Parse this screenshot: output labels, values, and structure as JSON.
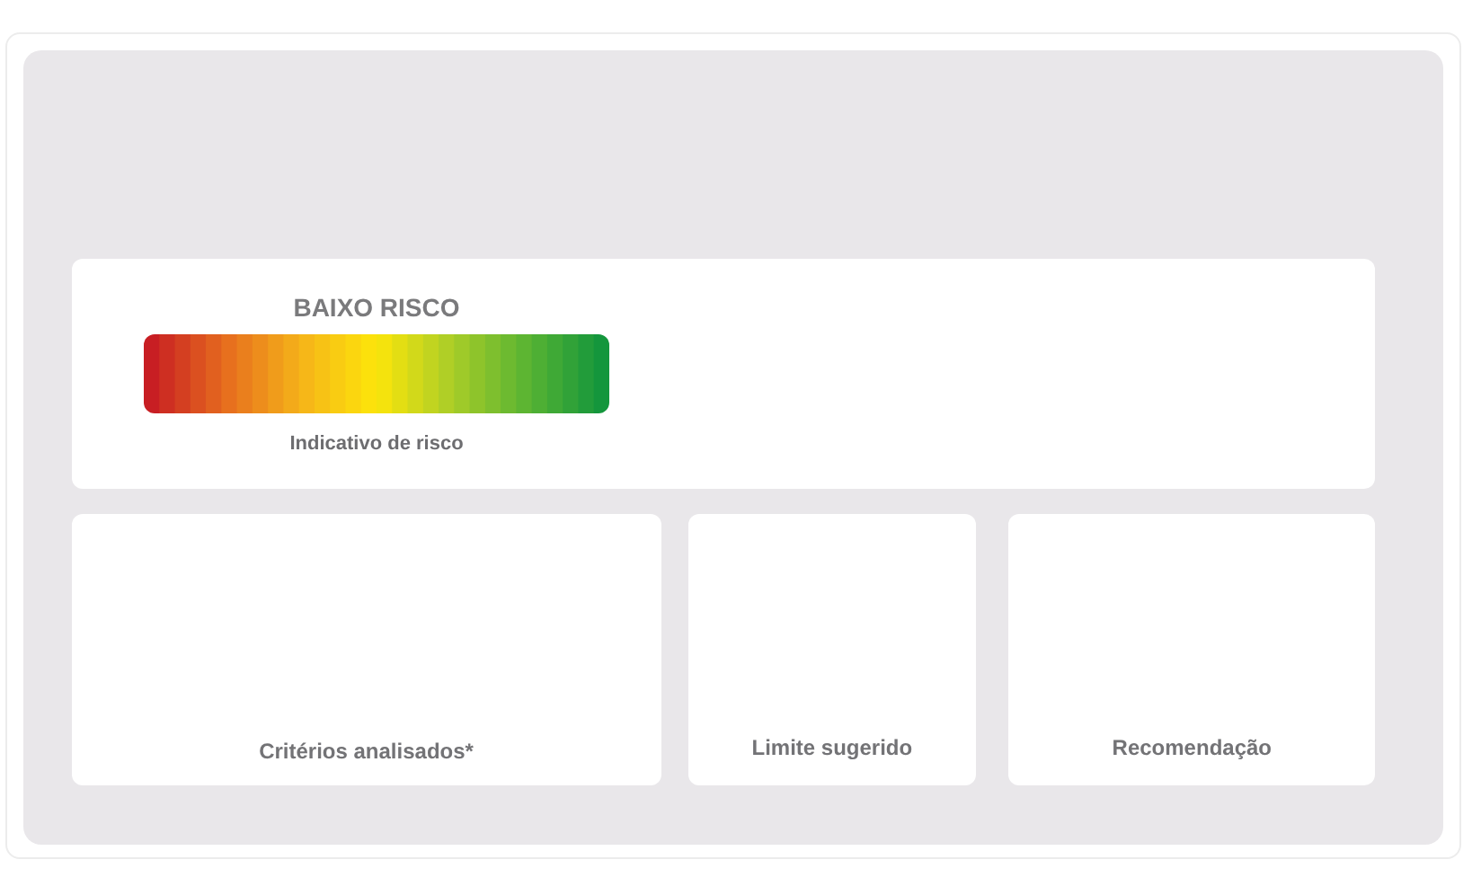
{
  "risk_card": {
    "label": "BAIXO RISCO",
    "caption": "Indicativo de risco"
  },
  "cards": [
    {
      "title": "Critérios analisados*"
    },
    {
      "title": "Limite sugerido"
    },
    {
      "title": "Recomendação"
    }
  ]
}
